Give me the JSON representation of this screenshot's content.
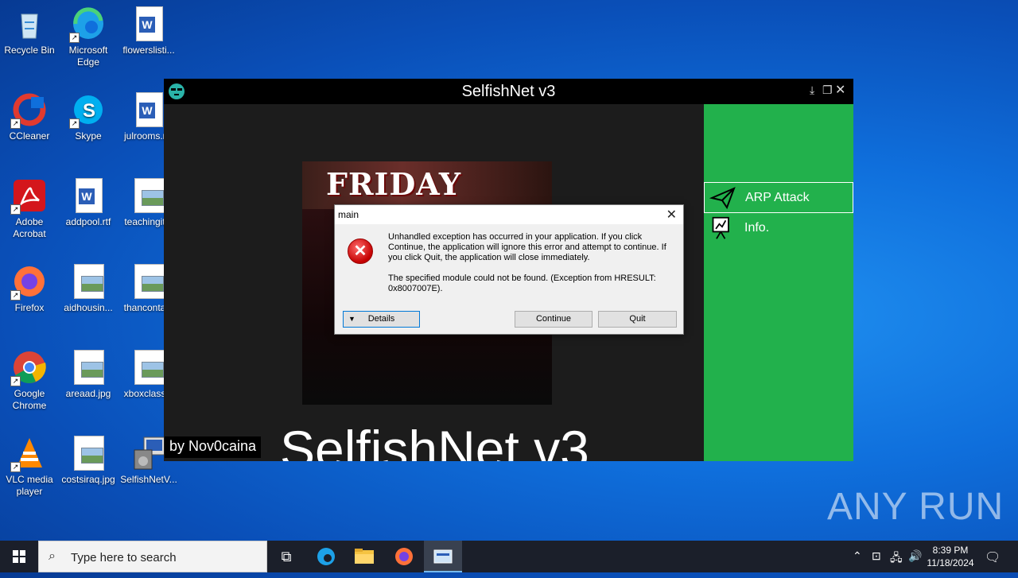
{
  "desktop": {
    "icons": [
      {
        "label": "Recycle Bin",
        "icon": "recycle-bin-icon"
      },
      {
        "label": "Microsoft Edge",
        "icon": "edge-icon"
      },
      {
        "label": "flowerslisti...",
        "icon": "word-doc-icon"
      },
      {
        "label": "CCleaner",
        "icon": "ccleaner-icon"
      },
      {
        "label": "Skype",
        "icon": "skype-icon"
      },
      {
        "label": "julrooms.r...",
        "icon": "word-doc-icon"
      },
      {
        "label": "Adobe Acrobat",
        "icon": "acrobat-icon"
      },
      {
        "label": "addpool.rtf",
        "icon": "word-doc-icon"
      },
      {
        "label": "teachingit...",
        "icon": "image-file-icon"
      },
      {
        "label": "Firefox",
        "icon": "firefox-icon"
      },
      {
        "label": "aidhousin...",
        "icon": "image-file-icon"
      },
      {
        "label": "thancontа...",
        "icon": "image-file-icon"
      },
      {
        "label": "Google Chrome",
        "icon": "chrome-icon"
      },
      {
        "label": "areaad.jpg",
        "icon": "image-file-icon"
      },
      {
        "label": "xboxclass...",
        "icon": "image-file-icon"
      },
      {
        "label": "VLC media player",
        "icon": "vlc-icon"
      },
      {
        "label": "costsiraq.jpg",
        "icon": "image-file-icon"
      },
      {
        "label": "SelfishNetV...",
        "icon": "installer-icon"
      }
    ]
  },
  "app": {
    "title": "SelfishNet v3",
    "menu": [
      {
        "label": "ARP Attack",
        "icon": "paper-plane-icon"
      },
      {
        "label": "Info.",
        "icon": "presentation-icon"
      }
    ],
    "poster_text": "FRIDAY",
    "byline": "by Nov0caina",
    "big_text": "SelfishNet v3",
    "colors": {
      "sidebar": "#22b14c",
      "titlebar": "#000000"
    }
  },
  "dialog": {
    "title": "main",
    "message1": "Unhandled exception has occurred in your application. If you click Continue, the application will ignore this error and attempt to continue. If you click Quit, the application will close immediately.",
    "message2": "The specified module could not be found. (Exception from HRESULT: 0x8007007E).",
    "details_label": "Details",
    "continue_label": "Continue",
    "quit_label": "Quit"
  },
  "taskbar": {
    "search_placeholder": "Type here to search",
    "time": "8:39 PM",
    "date": "11/18/2024"
  },
  "watermark": "ANY RUN"
}
